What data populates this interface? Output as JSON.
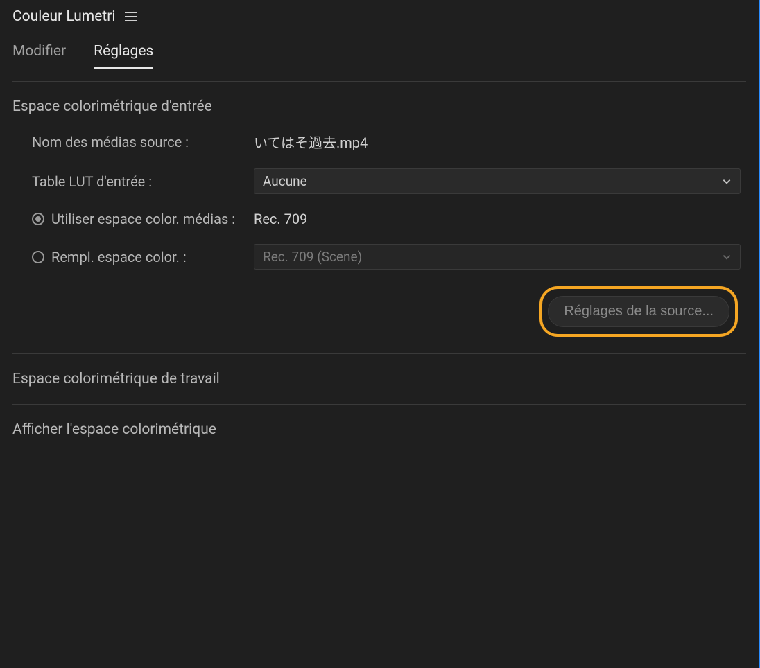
{
  "header": {
    "title": "Couleur Lumetri"
  },
  "tabs": {
    "modify": "Modifier",
    "settings": "Réglages"
  },
  "input_cs": {
    "title": "Espace colorimétrique d'entrée",
    "media_name_label": "Nom des médias source :",
    "media_name_value": "いてはそ過去.mp4",
    "input_lut_label": "Table LUT d'entrée :",
    "input_lut_value": "Aucune",
    "use_media_label": "Utiliser espace color. médias :",
    "use_media_value": "Rec. 709",
    "override_label": "Rempl. espace color. :",
    "override_value": "Rec. 709 (Scene)",
    "source_settings_btn": "Réglages de la source..."
  },
  "working_cs": {
    "title": "Espace colorimétrique de travail"
  },
  "display_cs": {
    "title": "Afficher l'espace colorimétrique"
  }
}
